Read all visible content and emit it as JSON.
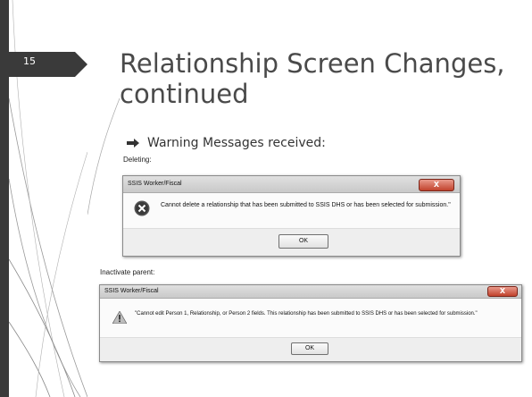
{
  "slide": {
    "number": "15",
    "title": "Relationship Screen Changes, continued",
    "bullet": "Warning Messages received:"
  },
  "captions": {
    "deleting": "Deleting:",
    "inactivate": "Inactivate parent:"
  },
  "dialogs": [
    {
      "title": "SSIS Worker/Fiscal",
      "close_label": "X",
      "icon": "error-icon",
      "message": "Cannot delete a relationship that has been submitted to SSIS DHS or has been selected for submission.\"",
      "ok_label": "OK"
    },
    {
      "title": "SSIS Worker/Fiscal",
      "close_label": "X",
      "icon": "warning-icon",
      "message": "\"Cannot edit Person 1, Relationship, or Person 2 fields. This relationship has been submitted to SSIS DHS or has been selected for submission.\"",
      "ok_label": "OK"
    }
  ],
  "colors": {
    "title": "#4a4a4a",
    "number_tab": "#3a3a3a",
    "close_button": "#c1422c"
  }
}
